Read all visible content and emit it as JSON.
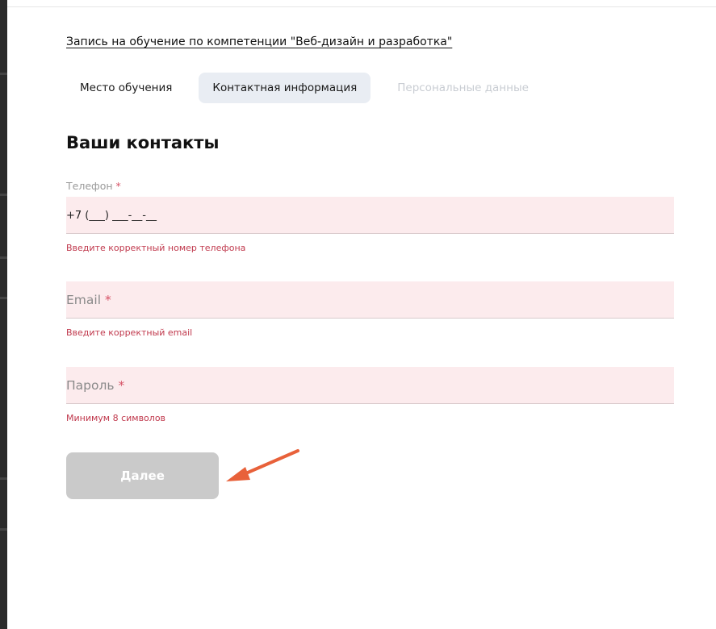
{
  "header": {
    "title": "Запись на обучение по компетенции \"Веб-дизайн и разработка\""
  },
  "tabs": [
    {
      "label": "Место обучения",
      "state": "done"
    },
    {
      "label": "Контактная информация",
      "state": "active"
    },
    {
      "label": "Персональные данные",
      "state": "disabled"
    }
  ],
  "form": {
    "heading": "Ваши контакты",
    "required_mark": "*",
    "phone": {
      "label": "Телефон",
      "value": "+7 (___) ___-__-__",
      "error": "Введите корректный номер телефона"
    },
    "email": {
      "placeholder": "Email",
      "value": "",
      "error": "Введите корректный email"
    },
    "password": {
      "placeholder": "Пароль",
      "value": "",
      "error": "Минимум 8 символов"
    },
    "submit_label": "Далее"
  },
  "colors": {
    "active_tab_bg": "#e9edf3",
    "field_error_bg": "#fcebed",
    "error_text": "#c0394d",
    "button_disabled_bg": "#cacaca",
    "annotation_arrow": "#e8613a"
  },
  "icons": {
    "annotation": "arrow-pointer-icon"
  }
}
